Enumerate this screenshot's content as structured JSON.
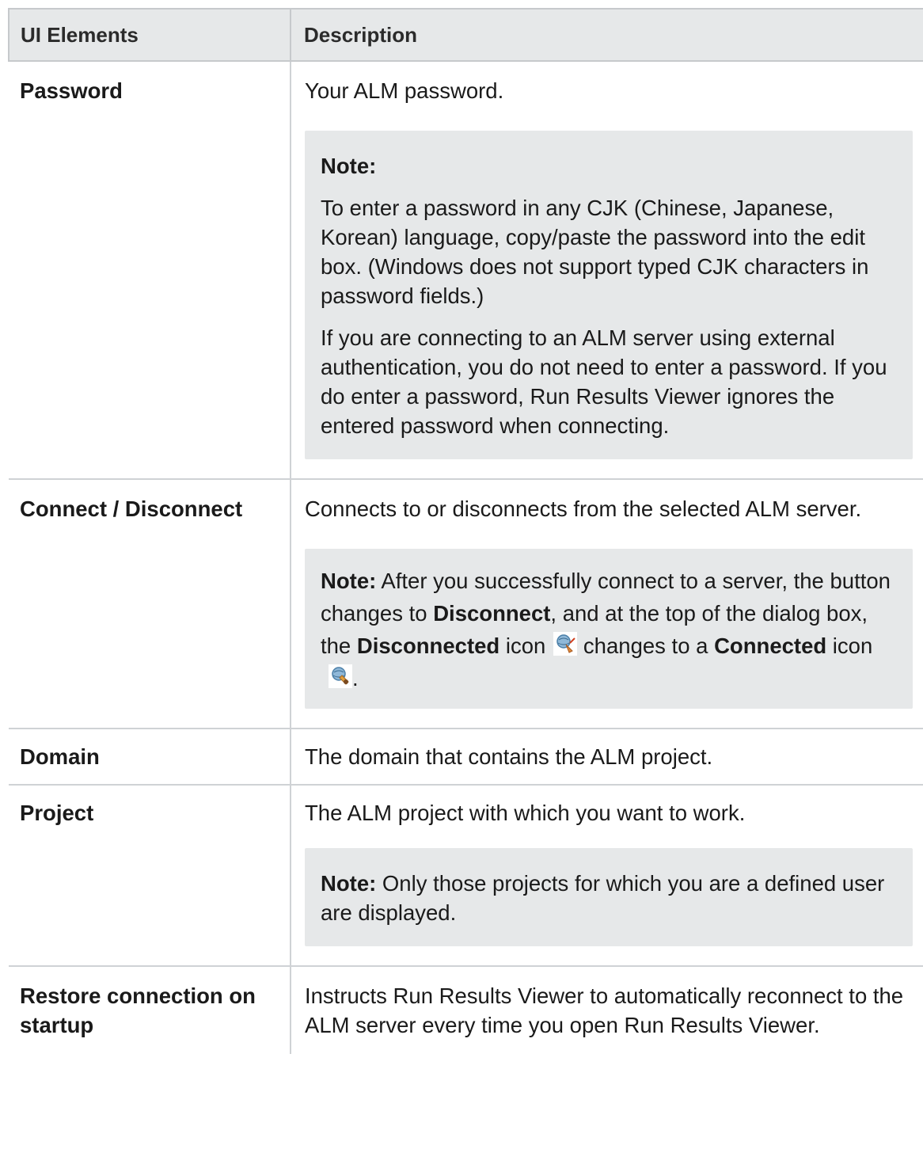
{
  "header": {
    "col1": "UI Elements",
    "col2": "Description"
  },
  "rows": {
    "password": {
      "name": "Password",
      "desc": "Your ALM password.",
      "note_label": "Note:",
      "note_p1": "To enter a password in any CJK (Chinese, Japanese, Korean) language, copy/paste the password into the edit box. (Windows does not support typed CJK characters in password fields.)",
      "note_p2": "If you are connecting to an ALM server using external authentication, you do not need to enter a password. If you do enter a password, Run Results Viewer ignores the entered password when connecting."
    },
    "connect": {
      "name": "Connect / Disconnect",
      "desc": "Connects to or disconnects from the selected ALM server.",
      "note_label": "Note:",
      "t1": " After you successfully connect to a server, the button changes to ",
      "b1": "Disconnect",
      "t2": ", and at the top of the dialog box, the ",
      "b2": "Disconnected",
      "t3": " icon",
      "t4": " changes to a ",
      "b3": "Connected",
      "t5": " icon",
      "t6": ".",
      "icons": [
        "disconnected-icon",
        "connected-icon"
      ]
    },
    "domain": {
      "name": "Domain",
      "desc": "The domain that contains the ALM project."
    },
    "project": {
      "name": "Project",
      "desc": "The ALM project with which you want to work.",
      "note_label": "Note:",
      "note_text": " Only those projects for which you are a defined user are displayed."
    },
    "restore": {
      "name": "Restore connection on startup",
      "desc": "Instructs Run Results Viewer to automatically reconnect to the ALM server every time you open Run Results Viewer."
    }
  }
}
